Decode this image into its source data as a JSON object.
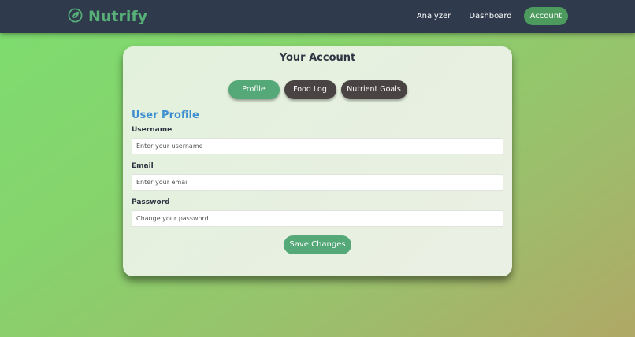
{
  "app": {
    "name": "Nutrify",
    "logo_icon": "leaf-icon",
    "accent": "#57b078"
  },
  "nav": {
    "items": [
      {
        "label": "Analyzer",
        "active": false
      },
      {
        "label": "Dashboard",
        "active": false
      },
      {
        "label": "Account",
        "active": true
      }
    ]
  },
  "card": {
    "title": "Your Account"
  },
  "tabs": [
    {
      "label": "Profile",
      "active": true
    },
    {
      "label": "Food Log",
      "active": false
    },
    {
      "label": "Nutrient Goals",
      "active": false
    }
  ],
  "profile": {
    "section_title": "User Profile",
    "username": {
      "label": "Username",
      "placeholder": "Enter your username",
      "value": ""
    },
    "email": {
      "label": "Email",
      "placeholder": "Enter your email",
      "value": ""
    },
    "password": {
      "label": "Password",
      "placeholder": "Change your password",
      "value": ""
    },
    "save_label": "Save Changes"
  },
  "colors": {
    "navbar": "#2f3a4c",
    "primary_green": "#55a877",
    "dark_tab": "#4a4343",
    "section_blue": "#3e8ed0"
  }
}
